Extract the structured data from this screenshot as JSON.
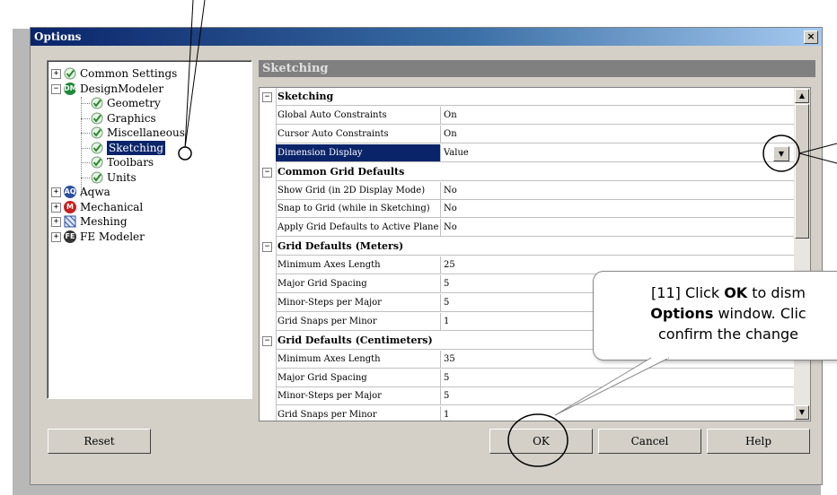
{
  "window": {
    "title": "Options",
    "close_label": "×"
  },
  "tree": {
    "items": [
      {
        "label": "Common Settings",
        "expander": "+"
      },
      {
        "label": "DesignModeler",
        "expander": "−",
        "badge": "DM"
      },
      {
        "label": "Geometry"
      },
      {
        "label": "Graphics"
      },
      {
        "label": "Miscellaneous"
      },
      {
        "label": "Sketching",
        "selected": true
      },
      {
        "label": "Toolbars"
      },
      {
        "label": "Units"
      },
      {
        "label": "Aqwa",
        "expander": "+",
        "badge": "AQ"
      },
      {
        "label": "Mechanical",
        "expander": "+",
        "badge": "M"
      },
      {
        "label": "Meshing",
        "expander": "+"
      },
      {
        "label": "FE Modeler",
        "expander": "+",
        "badge": "FE"
      }
    ]
  },
  "panel": {
    "header": "Sketching"
  },
  "grid": {
    "rows": [
      {
        "type": "category",
        "label": "Sketching"
      },
      {
        "type": "prop",
        "name": "Global Auto Constraints",
        "value": "On"
      },
      {
        "type": "prop",
        "name": "Cursor Auto Constraints",
        "value": "On"
      },
      {
        "type": "prop",
        "name": "Dimension Display",
        "value": "Value",
        "selected": true
      },
      {
        "type": "category",
        "label": "Common Grid Defaults"
      },
      {
        "type": "prop",
        "name": "Show Grid (in 2D Display Mode)",
        "value": "No"
      },
      {
        "type": "prop",
        "name": "Snap to Grid (while in Sketching)",
        "value": "No"
      },
      {
        "type": "prop",
        "name": "Apply Grid Defaults to Active Plane",
        "value": "No"
      },
      {
        "type": "category",
        "label": "Grid Defaults (Meters)"
      },
      {
        "type": "prop",
        "name": "Minimum Axes Length",
        "value": "25"
      },
      {
        "type": "prop",
        "name": "Major Grid Spacing",
        "value": "5"
      },
      {
        "type": "prop",
        "name": "Minor-Steps per Major",
        "value": "5"
      },
      {
        "type": "prop",
        "name": "Grid Snaps per Minor",
        "value": "1"
      },
      {
        "type": "category",
        "label": "Grid Defaults (Centimeters)"
      },
      {
        "type": "prop",
        "name": "Minimum Axes Length",
        "value": "35"
      },
      {
        "type": "prop",
        "name": "Major Grid Spacing",
        "value": "5"
      },
      {
        "type": "prop",
        "name": "Minor-Steps per Major",
        "value": "5"
      },
      {
        "type": "prop",
        "name": "Grid Snaps per Minor",
        "value": "1"
      }
    ]
  },
  "buttons": {
    "reset": "Reset",
    "ok": "OK",
    "cancel": "Cancel",
    "help": "Help"
  },
  "callout": {
    "prefix": "[11] Click ",
    "ok_word": "OK",
    "middle": " to dism",
    "options_word": "Options",
    "line2_rest": " window. Clic",
    "line3": "confirm the change"
  },
  "colors": {
    "selection": "#0a246a",
    "dialog_face": "#d4d0c8"
  }
}
